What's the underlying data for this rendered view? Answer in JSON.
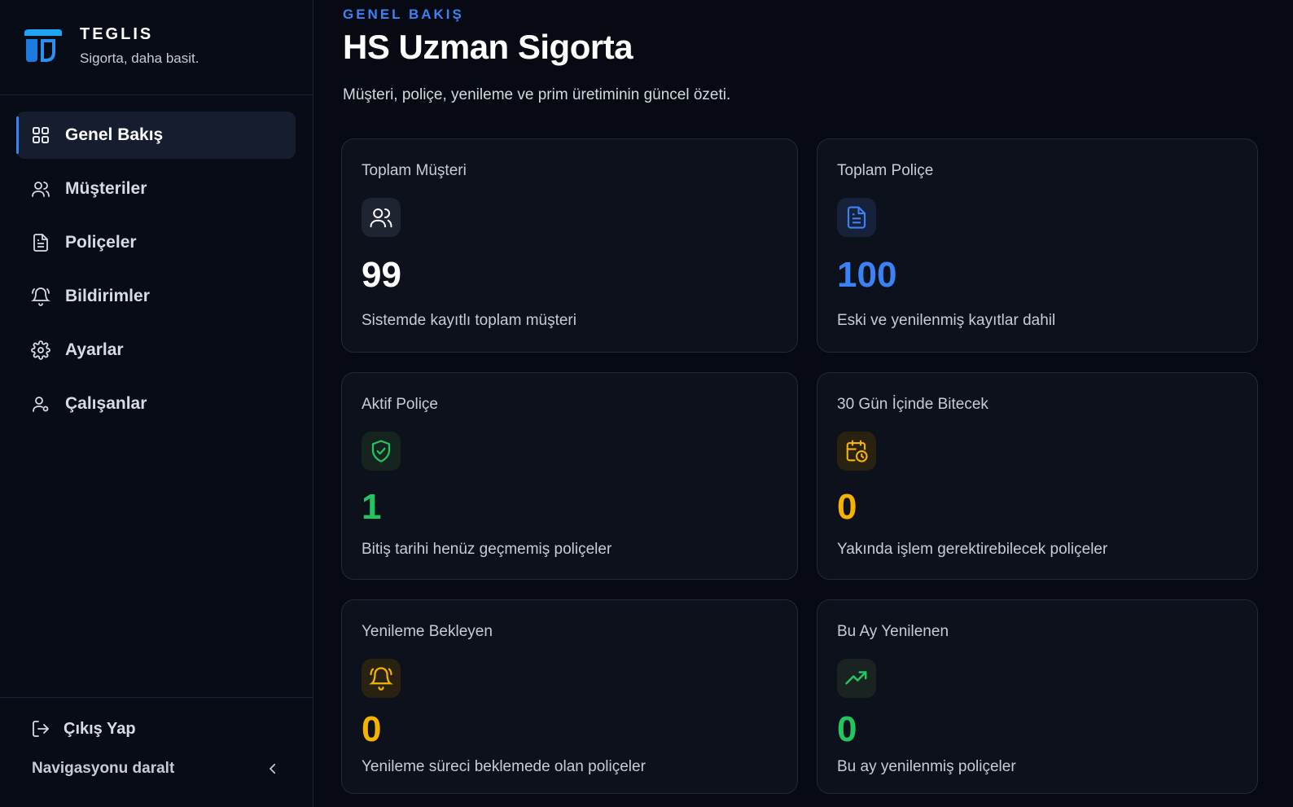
{
  "brand": {
    "name": "TEGLIS",
    "tagline": "Sigorta, daha basit."
  },
  "nav": [
    {
      "label": "Genel Bakış",
      "icon": "grid-icon",
      "active": true
    },
    {
      "label": "Müşteriler",
      "icon": "users-icon",
      "active": false
    },
    {
      "label": "Poliçeler",
      "icon": "document-icon",
      "active": false
    },
    {
      "label": "Bildirimler",
      "icon": "bell-icon",
      "active": false
    },
    {
      "label": "Ayarlar",
      "icon": "gear-icon",
      "active": false
    },
    {
      "label": "Çalışanlar",
      "icon": "user-icon",
      "active": false
    }
  ],
  "footer": {
    "logout": "Çıkış Yap",
    "collapse": "Navigasyonu daralt"
  },
  "header": {
    "eyebrow": "GENEL BAKIŞ",
    "title": "HS Uzman Sigorta",
    "subtitle": "Müşteri, poliçe, yenileme ve prim üretiminin güncel özeti."
  },
  "colors": {
    "accent": "#3b82f6",
    "white": "#ffffff",
    "blue": "#3b82f6",
    "green": "#22c55e",
    "amber": "#f5b300"
  },
  "stats": [
    {
      "label": "Toplam Müşteri",
      "value": "99",
      "desc": "Sistemde kayıtlı toplam müşteri",
      "icon": "users-icon",
      "color": "white"
    },
    {
      "label": "Toplam Poliçe",
      "value": "100",
      "desc": "Eski ve yenilenmiş kayıtlar dahil",
      "icon": "document-icon",
      "color": "blue"
    },
    {
      "label": "Aktif Poliçe",
      "value": "1",
      "desc": "Bitiş tarihi henüz geçmemiş poliçeler",
      "icon": "shield-check-icon",
      "color": "green"
    },
    {
      "label": "30 Gün İçinde Bitecek",
      "value": "0",
      "desc": "Yakında işlem gerektirebilecek poliçeler",
      "icon": "calendar-clock-icon",
      "color": "amber"
    },
    {
      "label": "Yenileme Bekleyen",
      "value": "0",
      "desc": "Yenileme süreci beklemede olan poliçeler",
      "icon": "bell-icon",
      "color": "amber"
    },
    {
      "label": "Bu Ay Yenilenen",
      "value": "0",
      "desc": "Bu ay yenilenmiş poliçeler",
      "icon": "trending-up-icon",
      "color": "green"
    }
  ]
}
